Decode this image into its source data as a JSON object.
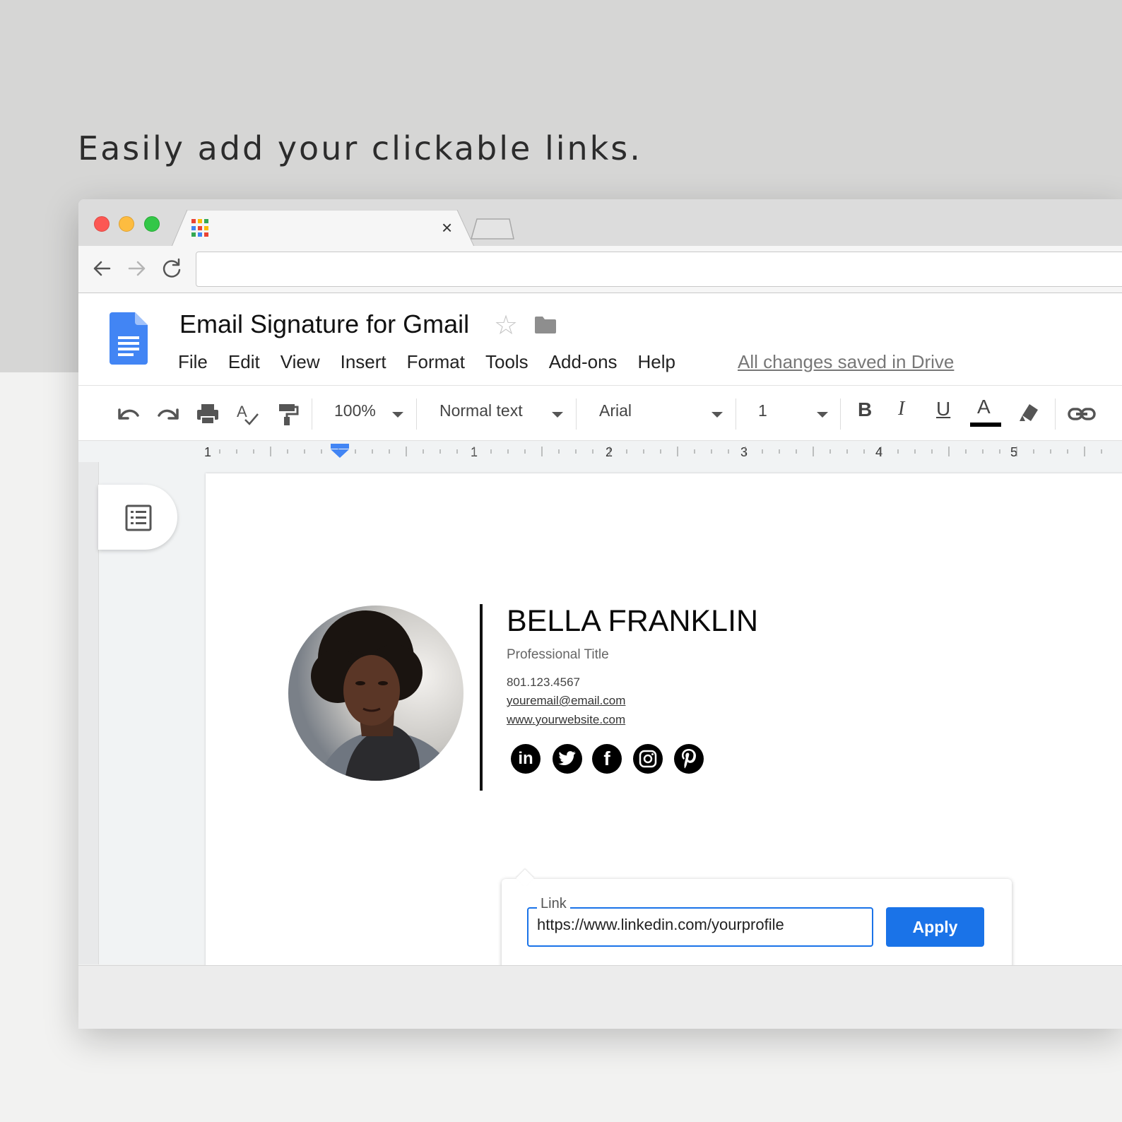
{
  "headline": "Easily add your clickable links.",
  "browser": {
    "tab_close": "×",
    "address_value": ""
  },
  "docs": {
    "title": "Email Signature for Gmail",
    "menu": [
      "File",
      "Edit",
      "View",
      "Insert",
      "Format",
      "Tools",
      "Add-ons",
      "Help"
    ],
    "saved_status": "All changes saved in Drive",
    "toolbar": {
      "zoom": "100%",
      "style": "Normal text",
      "font": "Arial",
      "font_size": "1",
      "bold": "B",
      "italic": "I",
      "underline": "U",
      "text_color": "A"
    },
    "ruler_labels": [
      "1",
      "1",
      "2",
      "3",
      "4",
      "5"
    ]
  },
  "signature": {
    "name": "BELLA FRANKLIN",
    "title": "Professional Title",
    "phone": "801.123.4567",
    "email": "youremail@email.com",
    "website": "www.yourwebsite.com",
    "social": [
      {
        "icon": "linkedin-icon",
        "glyph": "in"
      },
      {
        "icon": "twitter-icon",
        "glyph": ""
      },
      {
        "icon": "facebook-icon",
        "glyph": "f"
      },
      {
        "icon": "instagram-icon",
        "glyph": ""
      },
      {
        "icon": "pinterest-icon",
        "glyph": "P"
      }
    ]
  },
  "link_popup": {
    "label": "Link",
    "value": "https://www.linkedin.com/yourprofile",
    "apply": "Apply"
  },
  "colors": {
    "accent": "#1a73e8",
    "traffic_red": "#fc5753",
    "traffic_yellow": "#fdbc40",
    "traffic_green": "#33c748",
    "docs_blue": "#4285f4"
  }
}
